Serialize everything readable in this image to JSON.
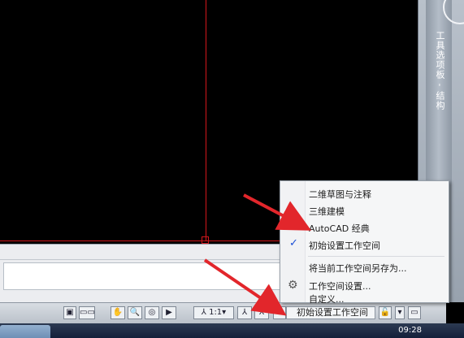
{
  "palette": {
    "title": "工具选项板 - 结构"
  },
  "statusbar": {
    "annotation_scale": "1:1▾",
    "workspace_current": "初始设置工作空间"
  },
  "taskbar": {
    "time": "09:28"
  },
  "workspace_menu": {
    "items": [
      {
        "label": "二维草图与注释",
        "checked": false
      },
      {
        "label": "三维建模",
        "checked": false
      },
      {
        "label": "AutoCAD 经典",
        "checked": false
      },
      {
        "label": "初始设置工作空间",
        "checked": true
      },
      {
        "label": "将当前工作空间另存为...",
        "checked": false
      },
      {
        "label": "工作空间设置...",
        "checked": false,
        "icon": "gear-icon"
      },
      {
        "label": "自定义...",
        "checked": false
      }
    ]
  },
  "colors": {
    "annotation_arrow": "#e2262b",
    "check": "#1b4fd6",
    "canvas_line": "#d4161b"
  }
}
